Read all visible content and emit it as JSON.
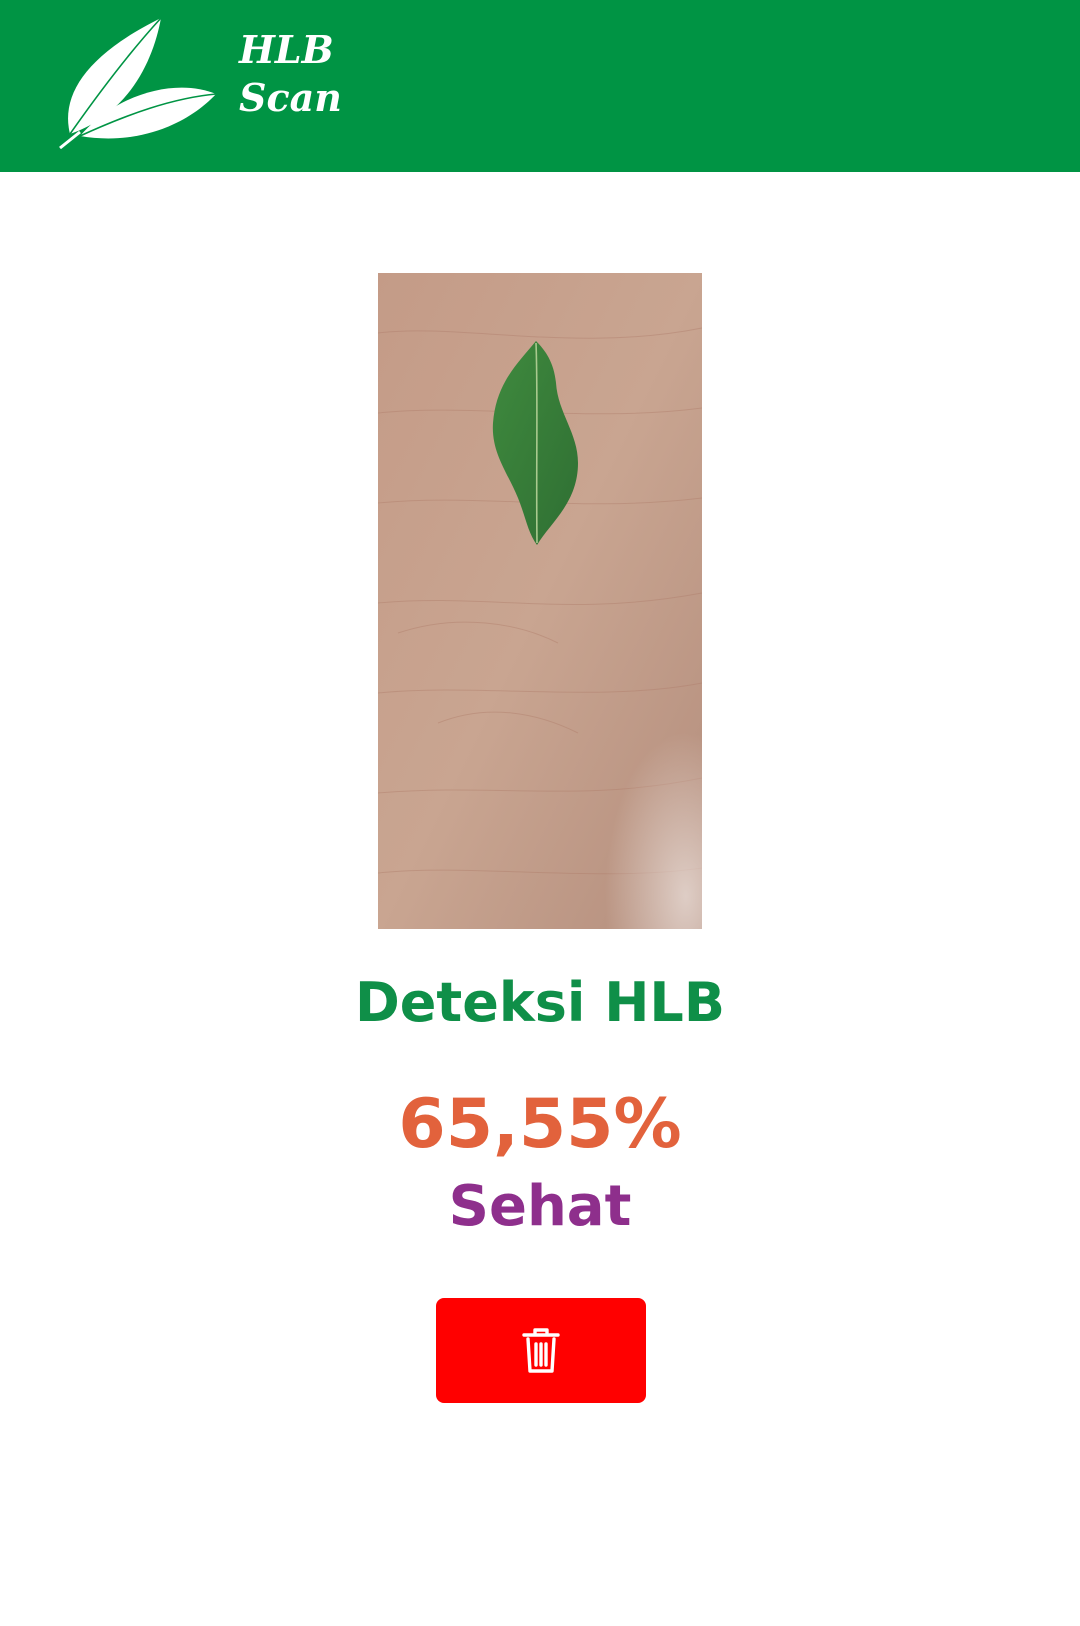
{
  "header": {
    "brand_line1": "HLB",
    "brand_line2": "Scan",
    "background": "#009444",
    "logo_icon": "leaf-icon"
  },
  "result": {
    "photo_description_icon": "leaf-photo",
    "title": "Deteksi HLB",
    "percent": "65,55%",
    "label": "Sehat",
    "title_color": "#0f8f48",
    "percent_color": "#e2623c",
    "label_color": "#8e2f8c"
  },
  "actions": {
    "delete_icon": "trash-icon",
    "delete_color": "#ff0000"
  }
}
